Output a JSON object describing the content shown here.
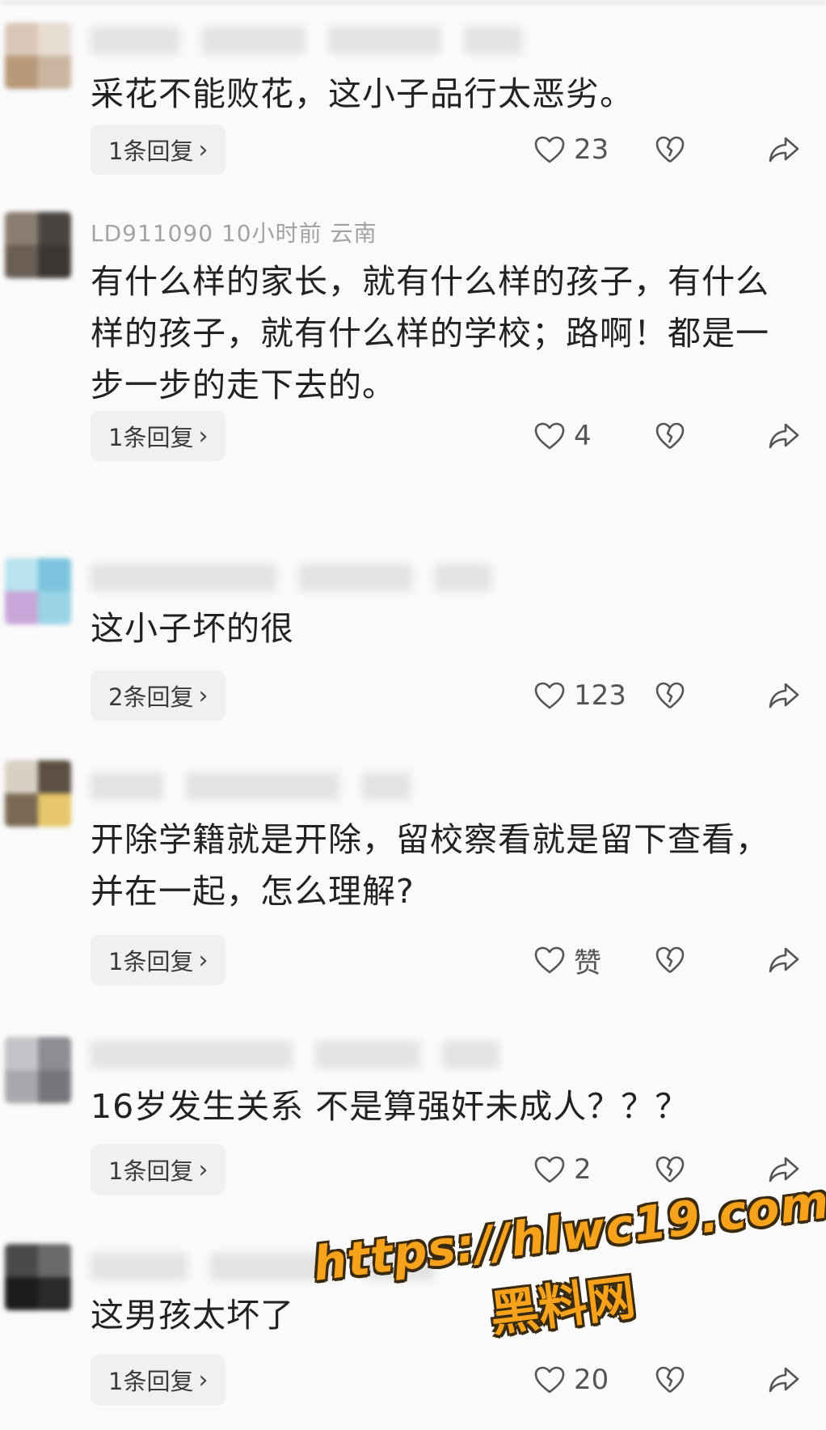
{
  "comments": [
    {
      "meta": "",
      "text": "采花不能败花，这小子品行太恶劣。",
      "reply_label": "1条回复",
      "likes": "23",
      "avatar_colors": [
        "#d9c8b8",
        "#b89a7a",
        "#e8ddd2",
        "#c9b5a0"
      ]
    },
    {
      "meta": "LD911090  10小时前  云南",
      "text": "有什么样的家长，就有什么样的孩子，有什么样的孩子，就有什么样的学校；路啊！都是一步一步的走下去的。",
      "reply_label": "1条回复",
      "likes": "4",
      "avatar_colors": [
        "#6b5f55",
        "#4a4440",
        "#8a7d72",
        "#3c3633"
      ]
    },
    {
      "meta": "",
      "text": "这小子坏的很",
      "reply_label": "2条回复",
      "likes": "123",
      "avatar_colors": [
        "#9ad3e6",
        "#c9a6d9",
        "#7cc4de",
        "#b9e2ee"
      ]
    },
    {
      "meta": "",
      "text": "开除学籍就是开除，留校察看就是留下查看，并在一起，怎么理解?",
      "reply_label": "1条回复",
      "likes": "赞",
      "avatar_colors": [
        "#7a6a55",
        "#e6c66a",
        "#d8d0c4",
        "#5c5044"
      ]
    },
    {
      "meta": "",
      "text": "16岁发生关系 不是算强奸未成人？？？",
      "reply_label": "1条回复",
      "likes": "2",
      "avatar_colors": [
        "#a9a9ad",
        "#8d8d92",
        "#c4c4c8",
        "#76767c"
      ]
    },
    {
      "meta": "",
      "text": "这男孩太坏了",
      "reply_label": "1条回复",
      "likes": "20",
      "avatar_colors": [
        "#2a2a2a",
        "#4a4a4a",
        "#1c1c1c",
        "#6a6a6a"
      ]
    }
  ],
  "watermark": {
    "url": "https://hlwc19.com",
    "name": "黑料网"
  },
  "icons": {
    "like": "heart-outline-icon",
    "dislike": "broken-heart-icon",
    "share": "share-arrow-icon",
    "reply_arrow": "chevron-right-icon"
  },
  "colors": {
    "watermark_fill": "#f7a21b",
    "watermark_outline": "#3a2a10"
  }
}
